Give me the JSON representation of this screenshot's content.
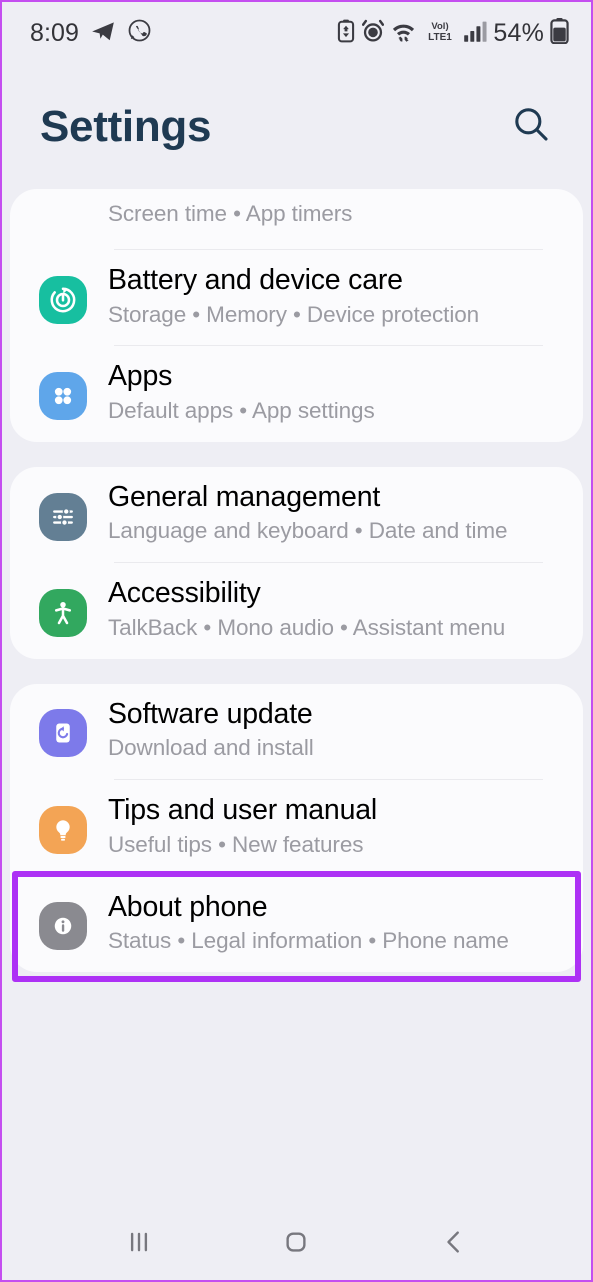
{
  "status_bar": {
    "time": "8:09",
    "battery_percent": "54%",
    "network_label": "VoLTE1",
    "left_icons": [
      "telegram-icon",
      "whatsapp-icon"
    ],
    "right_icons": [
      "battery-saver-icon",
      "alarm-icon",
      "wifi-icon",
      "volte-icon",
      "signal-bars-icon",
      "battery-icon"
    ]
  },
  "header": {
    "title": "Settings",
    "title_color": "#1f3a52",
    "search_icon": "search-icon"
  },
  "groups": [
    {
      "rows": [
        {
          "id": "digital-wellbeing",
          "partial": true,
          "title": "",
          "subtitle": "Screen time  •  App timers",
          "icon": null
        },
        {
          "id": "battery-and-device-care",
          "title": "Battery and device care",
          "subtitle": "Storage  •  Memory  •  Device protection",
          "icon": "battery-care-icon",
          "icon_color": "#17bfa0"
        },
        {
          "id": "apps",
          "title": "Apps",
          "subtitle": "Default apps  •  App settings",
          "icon": "apps-grid-icon",
          "icon_color": "#5fa6ea"
        }
      ]
    },
    {
      "rows": [
        {
          "id": "general-management",
          "title": "General management",
          "subtitle": "Language and keyboard  •  Date and time",
          "icon": "sliders-icon",
          "icon_color": "#637f94"
        },
        {
          "id": "accessibility",
          "title": "Accessibility",
          "subtitle": "TalkBack  •  Mono audio  •  Assistant menu",
          "icon": "accessibility-person-icon",
          "icon_color": "#32a85f"
        }
      ]
    },
    {
      "rows": [
        {
          "id": "software-update",
          "title": "Software update",
          "subtitle": "Download and install",
          "icon": "software-update-icon",
          "icon_color": "#7d7aea"
        },
        {
          "id": "tips-and-user-manual",
          "title": "Tips and user manual",
          "subtitle": "Useful tips  •  New features",
          "icon": "lightbulb-icon",
          "icon_color": "#f5a council"
        },
        {
          "id": "about-phone",
          "title": "About phone",
          "subtitle": "Status  •  Legal information  •  Phone name",
          "icon": "info-icon",
          "icon_color": "#8a8a90",
          "highlighted": true
        }
      ]
    }
  ],
  "annotation": {
    "target": "about-phone",
    "color": "#ad31f5"
  },
  "nav_bar": {
    "recents_icon": "recents-icon",
    "home_icon": "home-icon",
    "back_icon": "back-icon"
  },
  "colors": {
    "page_background": "#eeeef4",
    "card_background": "#fbfbfd",
    "title_text": "#000000",
    "subtitle_text": "#9b9ba2",
    "divider": "#eaeaee",
    "highlight": "#ad31f5"
  }
}
